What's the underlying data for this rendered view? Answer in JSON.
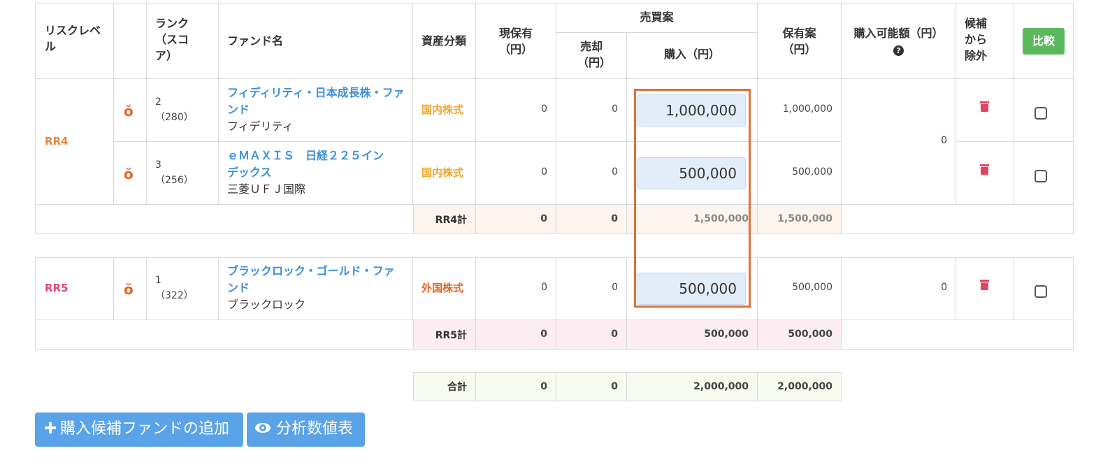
{
  "header": {
    "risk_level": "リスクレベル",
    "rank": "ランク（スコア）",
    "fund_name": "ファンド名",
    "asset_class": "資産分類",
    "current_holding": "現保有（円）",
    "trade_plan": "売買案",
    "sell": "売却（円）",
    "buy": "購入（円）",
    "holding_plan": "保有案（円）",
    "purchasable": "購入可能額（円）",
    "exclude": "候補から除外",
    "compare": "比較"
  },
  "groups": [
    {
      "risk": "RR4",
      "risk_color": "#e8843a",
      "purchasable": "0",
      "rows": [
        {
          "rank": "2",
          "score": "（280）",
          "name1": "フィディリティ・日本成長株・ファ",
          "name2": "ンド",
          "company": "フィデリティ",
          "asset": "国内株式",
          "asset_color": "#f0a830",
          "current": "0",
          "sell": "0",
          "buy": "1,000,000",
          "holding": "1,000,000"
        },
        {
          "rank": "3",
          "score": "（256）",
          "name1": "ｅＭＡＸＩＳ　日経２２５イン",
          "name2": "デックス",
          "company": "三菱ＵＦＪ国際",
          "asset": "国内株式",
          "asset_color": "#f0a830",
          "current": "0",
          "sell": "0",
          "buy": "500,000",
          "holding": "500,000"
        }
      ],
      "subtotal": {
        "label": "RR4計",
        "current": "0",
        "sell": "0",
        "buy": "1,500,000",
        "holding": "1,500,000"
      }
    },
    {
      "risk": "RR5",
      "risk_color": "#e0457b",
      "purchasable": "0",
      "rows": [
        {
          "rank": "1",
          "score": "（322）",
          "name1": "ブラックロック・ゴールド・ファ",
          "name2": "ンド",
          "company": "ブラックロック",
          "asset": "外国株式",
          "asset_color": "#e8662a",
          "current": "0",
          "sell": "0",
          "buy": "500,000",
          "holding": "500,000"
        }
      ],
      "subtotal": {
        "label": "RR5計",
        "current": "0",
        "sell": "0",
        "buy": "500,000",
        "holding": "500,000"
      }
    }
  ],
  "total": {
    "label": "合計",
    "current": "0",
    "sell": "0",
    "buy": "2,000,000",
    "holding": "2,000,000"
  },
  "buttons": {
    "add_fund": "購入候補ファンドの追加",
    "analysis": "分析数値表"
  },
  "colors": {
    "highlight": "#e0703a",
    "accent": "#3a8fdc",
    "compare": "#5cb85c",
    "trash": "#e04560"
  }
}
